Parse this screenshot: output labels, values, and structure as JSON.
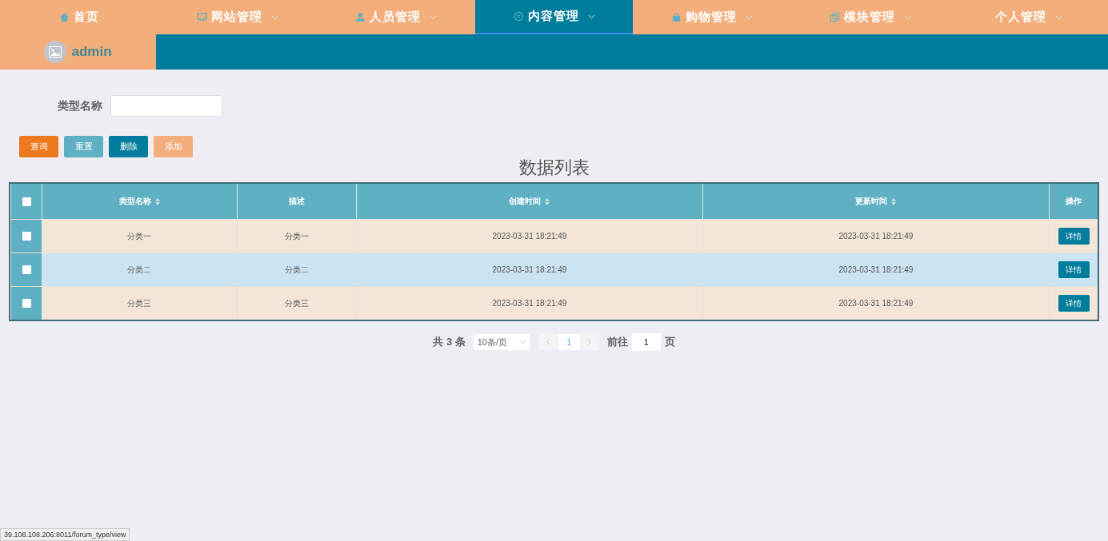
{
  "nav": {
    "items": [
      {
        "label": "首页",
        "kind": "home",
        "dropdown": false,
        "selected": false
      },
      {
        "label": "网站管理",
        "kind": "monitor",
        "dropdown": true,
        "selected": false
      },
      {
        "label": "人员管理",
        "kind": "person",
        "dropdown": true,
        "selected": false
      },
      {
        "label": "内容管理",
        "kind": "chat",
        "dropdown": true,
        "selected": true
      },
      {
        "label": "购物管理",
        "kind": "bag",
        "dropdown": true,
        "selected": false
      },
      {
        "label": "模块管理",
        "kind": "copy",
        "dropdown": true,
        "selected": false
      },
      {
        "label": "个人管理",
        "kind": "plain",
        "dropdown": true,
        "selected": false
      }
    ],
    "user": "admin"
  },
  "search": {
    "label": "类型名称"
  },
  "buttons": [
    {
      "label": "查询",
      "kind": "query"
    },
    {
      "label": "重置",
      "kind": "reset"
    },
    {
      "label": "删除",
      "kind": "delete"
    },
    {
      "label": "添加",
      "kind": "add"
    }
  ],
  "table": {
    "title": "数据列表",
    "header_checked": false,
    "columns": [
      {
        "label": "类型名称",
        "sortable": true
      },
      {
        "label": "描述",
        "sortable": false
      },
      {
        "label": "创建时间",
        "sortable": true
      },
      {
        "label": "更新时间",
        "sortable": true
      },
      {
        "label": "操作",
        "sortable": false
      }
    ],
    "rows": [
      {
        "checked": false,
        "hovered": false,
        "cells": [
          "分类一",
          "分类一",
          "2023-03-31 18:21:49",
          "2023-03-31 18:21:49"
        ],
        "action": "详情"
      },
      {
        "checked": false,
        "hovered": true,
        "cells": [
          "分类二",
          "分类二",
          "2023-03-31 18:21:49",
          "2023-03-31 18:21:49"
        ],
        "action": "详情"
      },
      {
        "checked": false,
        "hovered": false,
        "cells": [
          "分类三",
          "分类三",
          "2023-03-31 18:21:49",
          "2023-03-31 18:21:49"
        ],
        "action": "详情"
      }
    ]
  },
  "pagination": {
    "total": "共 3 条",
    "page_size": "10条/页",
    "pages": [
      {
        "label": "1",
        "selected": true
      }
    ],
    "goto_label": "前往",
    "goto_value": "1",
    "goto_suffix": "页"
  },
  "status_url": "39.108.108.206:8011/forum_type/view"
}
